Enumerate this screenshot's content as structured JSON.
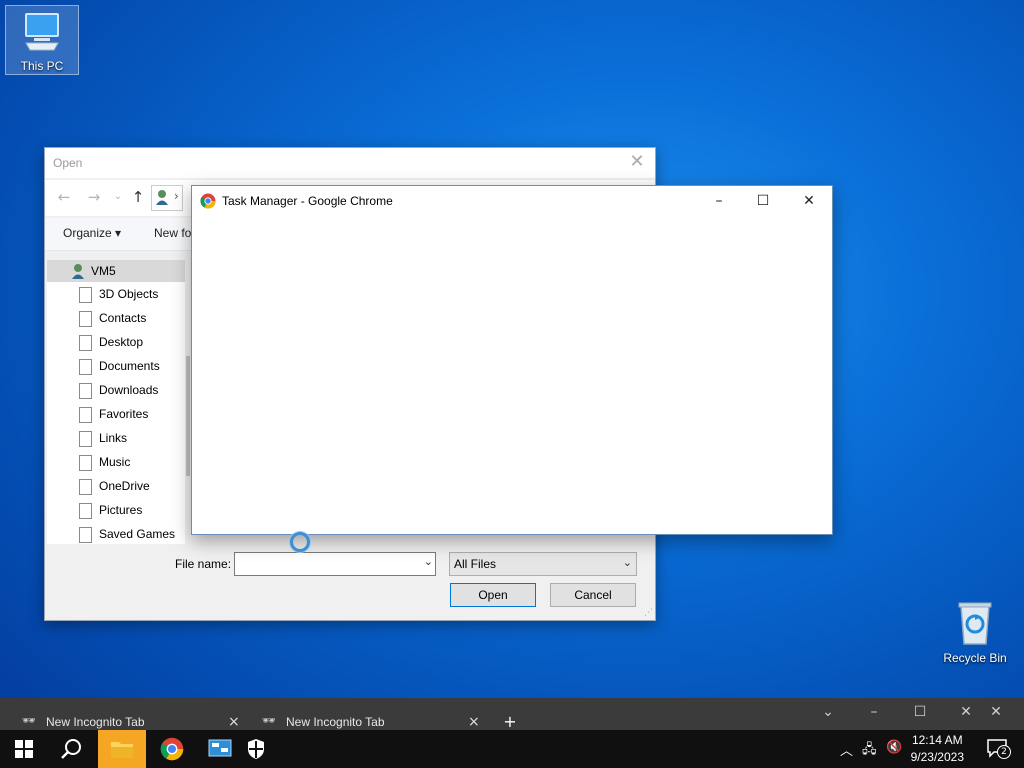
{
  "desktop": {
    "this_pc_label": "This PC",
    "recycle_bin_label": "Recycle Bin"
  },
  "open_dialog": {
    "title": "Open",
    "organize_label": "Organize ▾",
    "new_folder_label": "New fo",
    "tree_root": "VM5",
    "tree_items": [
      "3D Objects",
      "Contacts",
      "Desktop",
      "Documents",
      "Downloads",
      "Favorites",
      "Links",
      "Music",
      "OneDrive",
      "Pictures",
      "Saved Games"
    ],
    "file_name_label": "File name:",
    "file_name_value": "",
    "file_type": "All Files",
    "open_button": "Open",
    "cancel_button": "Cancel"
  },
  "task_manager": {
    "title": "Task Manager - Google Chrome"
  },
  "browser_tabs": [
    {
      "label": "New Incognito Tab"
    },
    {
      "label": "New Incognito Tab"
    }
  ],
  "taskbar": {
    "time": "12:14 AM",
    "date": "9/23/2023",
    "notification_count": "2"
  }
}
